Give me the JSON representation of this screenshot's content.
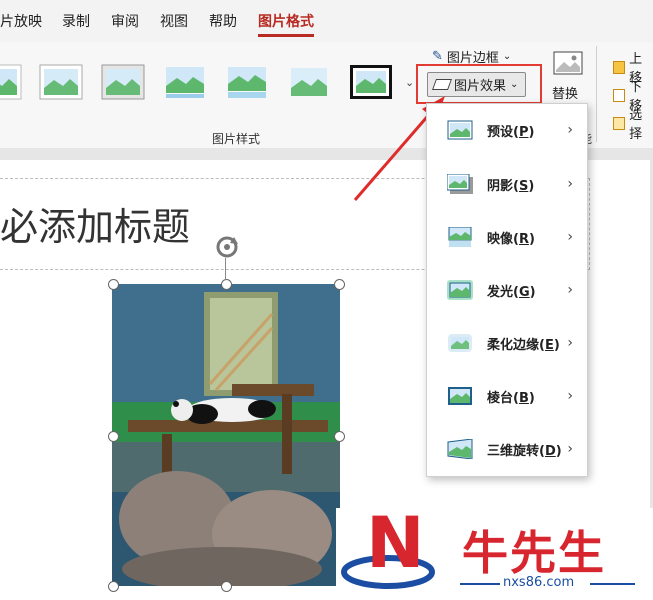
{
  "tabs": [
    {
      "label": "片放映"
    },
    {
      "label": "录制"
    },
    {
      "label": "审阅"
    },
    {
      "label": "视图"
    },
    {
      "label": "帮助"
    },
    {
      "label": "图片格式"
    }
  ],
  "ribbon": {
    "border_label": "图片边框",
    "effects_label": "图片效果",
    "replace_label": "替换",
    "styles_group_label": "图片样式",
    "right_group_label_fragment": "能",
    "right_items": [
      "上移",
      "下移",
      "选择"
    ]
  },
  "slide": {
    "title_text": "必添加标题"
  },
  "effects_menu": {
    "items": [
      {
        "label": "预设(P)",
        "text": "预设(",
        "key": "P",
        "tail": ")"
      },
      {
        "label": "阴影(S)",
        "text": "阴影(",
        "key": "S",
        "tail": ")"
      },
      {
        "label": "映像(R)",
        "text": "映像(",
        "key": "R",
        "tail": ")"
      },
      {
        "label": "发光(G)",
        "text": "发光(",
        "key": "G",
        "tail": ")"
      },
      {
        "label": "柔化边缘(E)",
        "text": "柔化边缘(",
        "key": "E",
        "tail": ")"
      },
      {
        "label": "棱台(B)",
        "text": "棱台(",
        "key": "B",
        "tail": ")"
      },
      {
        "label": "三维旋转(D)",
        "text": "三维旋转(",
        "key": "D",
        "tail": ")"
      }
    ]
  },
  "watermark": {
    "logo_letter": "N",
    "text": "牛先生",
    "url": "nxs86.com"
  },
  "colors": {
    "accent": "#b72b23",
    "highlight_box": "#e23b33"
  }
}
